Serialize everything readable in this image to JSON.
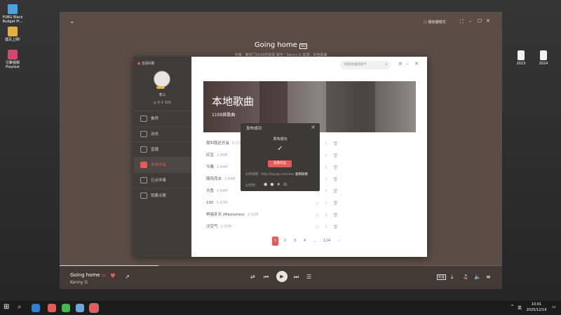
{
  "desktop": {
    "icons_left": [
      {
        "label": "PUBG Black Budget Pl...",
        "color": "#4aa3df"
      },
      {
        "label": "遇见上网!",
        "color": "#e0b040"
      },
      {
        "label": "引擎视频 Playtest",
        "color": "#d0486a"
      }
    ],
    "icons_right": [
      {
        "label": "2023"
      },
      {
        "label": "2024"
      }
    ]
  },
  "player": {
    "song_title": "Going home",
    "song_badge": "SQ",
    "song_meta": "专辑：教材门2016的故事   歌手：Kenny G   来源：本地歌曲",
    "mode_label": "播放器模式",
    "bar_title": "Going home",
    "bar_artist": "Kenny G",
    "bar_badge": "SQ",
    "quality_label": "标准",
    "progress_fraction": 0.224
  },
  "sidebar": {
    "brand": "全民K歌",
    "user_name": "李三",
    "level_badge": "LV13",
    "stats": "◎ 0   ⚲ 105",
    "items": [
      {
        "label": "推荐",
        "active": false
      },
      {
        "label": "动态",
        "active": false
      },
      {
        "label": "直播",
        "active": false
      },
      {
        "label": "本地作品",
        "active": true
      },
      {
        "label": "已点伴奏",
        "active": false
      },
      {
        "label": "我要点歌",
        "active": false
      }
    ]
  },
  "main": {
    "search_placeholder": "搜索歌曲或歌手",
    "banner_title": "本地歌曲",
    "banner_count": "1109首歌曲",
    "songs": [
      {
        "name": "我叫我还开会",
        "size": "5.17M"
      },
      {
        "name": "红豆",
        "size": "2.30M"
      },
      {
        "name": "今晚",
        "size": "1.44M"
      },
      {
        "name": "随风而去",
        "size": "2.64M"
      },
      {
        "name": "大鱼",
        "size": "2.64M"
      },
      {
        "name": "100",
        "size": "3.47M"
      },
      {
        "name": "再唱冬天 (Memories)",
        "size": "2.52M"
      },
      {
        "name": "冷空气",
        "size": "2.41M"
      }
    ],
    "pages": [
      "1",
      "2",
      "3",
      "4",
      "...",
      "124"
    ],
    "current_page": "1",
    "next_label": "›"
  },
  "popup": {
    "title": "发布成功",
    "headline": "发布成功",
    "view_button": "查看作品",
    "link_label": "分享链接：http://kg.qq.com/xxx",
    "copy_label": "复制链接",
    "share_label": "分享到："
  },
  "taskbar": {
    "time": "10:01",
    "date": "2025/12/19",
    "lang": "英"
  },
  "colors": {
    "accent": "#e85a57",
    "player_bg": "#5b4d45",
    "sidebar_bg": "#3f3b39"
  }
}
